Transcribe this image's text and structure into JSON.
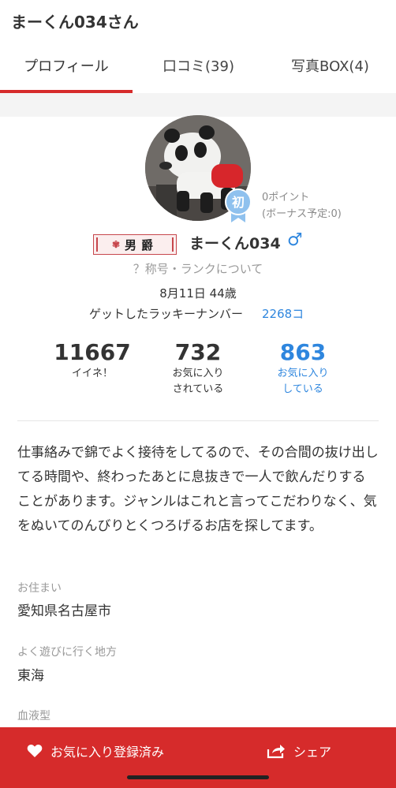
{
  "header": {
    "title": "まーくん034さん"
  },
  "tabs": [
    {
      "label": "プロフィール",
      "active": true
    },
    {
      "label": "口コミ(39)"
    },
    {
      "label": "写真BOX(4)"
    }
  ],
  "profile": {
    "badge_text": "初",
    "points": "0ポイント",
    "bonus": "(ボーナス予定:0)",
    "rank_title": "男爵",
    "username": "まーくん034",
    "gender_symbol": "♂",
    "title_link": "？称号・ランクについて",
    "birth_age": "8月11日 44歳",
    "lucky_label": "ゲットしたラッキーナンバー",
    "lucky_value": "2268コ"
  },
  "stats": [
    {
      "value": "11667",
      "label_1": "イイネ！",
      "label_2": ""
    },
    {
      "value": "732",
      "label_1": "お気に入り",
      "label_2": "されている"
    },
    {
      "value": "863",
      "label_1": "お気に入り",
      "label_2": "している"
    }
  ],
  "bio": "仕事絡みで錦でよく接待をしてるので、その合間の抜け出してる時間や、終わったあとに息抜きで一人で飲んだりすることがあります。ジャンルはこれと言ってこだわりなく、気をぬいてのんびりとくつろげるお店を探してます。",
  "fields": [
    {
      "label": "お住まい",
      "value": "愛知県名古屋市"
    },
    {
      "label": "よく遊びに行く地方",
      "value": "東海"
    },
    {
      "label": "血液型",
      "value": ""
    }
  ],
  "bottom_bar": {
    "favorite_label": "お気に入り登録済み",
    "share_label": "シェア"
  },
  "colors": {
    "accent_red": "#d62b2b",
    "link_blue": "#2e86de",
    "badge_blue": "#8fc1ee"
  },
  "icons": [
    "heart-icon",
    "share-icon",
    "male-icon",
    "beginner-badge-icon"
  ]
}
